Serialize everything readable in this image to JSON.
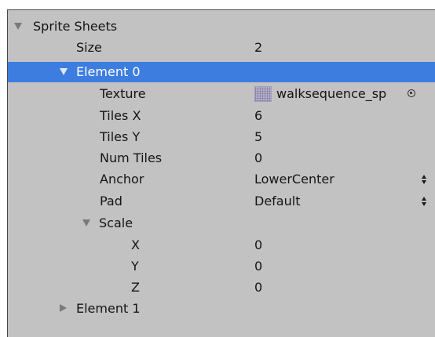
{
  "inspector": {
    "sprite_sheets": {
      "label": "Sprite Sheets",
      "expanded": true
    },
    "size": {
      "label": "Size",
      "value": "2"
    },
    "element0": {
      "label": "Element 0",
      "expanded": true,
      "selected": true
    },
    "texture": {
      "label": "Texture",
      "value": "walksequence_sp",
      "icon": "texture-thumbnail-icon"
    },
    "tiles_x": {
      "label": "Tiles X",
      "value": "6"
    },
    "tiles_y": {
      "label": "Tiles Y",
      "value": "5"
    },
    "num_tiles": {
      "label": "Num Tiles",
      "value": "0"
    },
    "anchor": {
      "label": "Anchor",
      "value": "LowerCenter"
    },
    "pad": {
      "label": "Pad",
      "value": "Default"
    },
    "scale": {
      "label": "Scale",
      "expanded": true,
      "x": {
        "label": "X",
        "value": "0"
      },
      "y": {
        "label": "Y",
        "value": "0"
      },
      "z": {
        "label": "Z",
        "value": "0"
      }
    },
    "element1": {
      "label": "Element 1",
      "expanded": false
    }
  },
  "colors": {
    "panel_background": "#c2c2c2",
    "selection": "#3e7de0",
    "text": "#141414"
  }
}
